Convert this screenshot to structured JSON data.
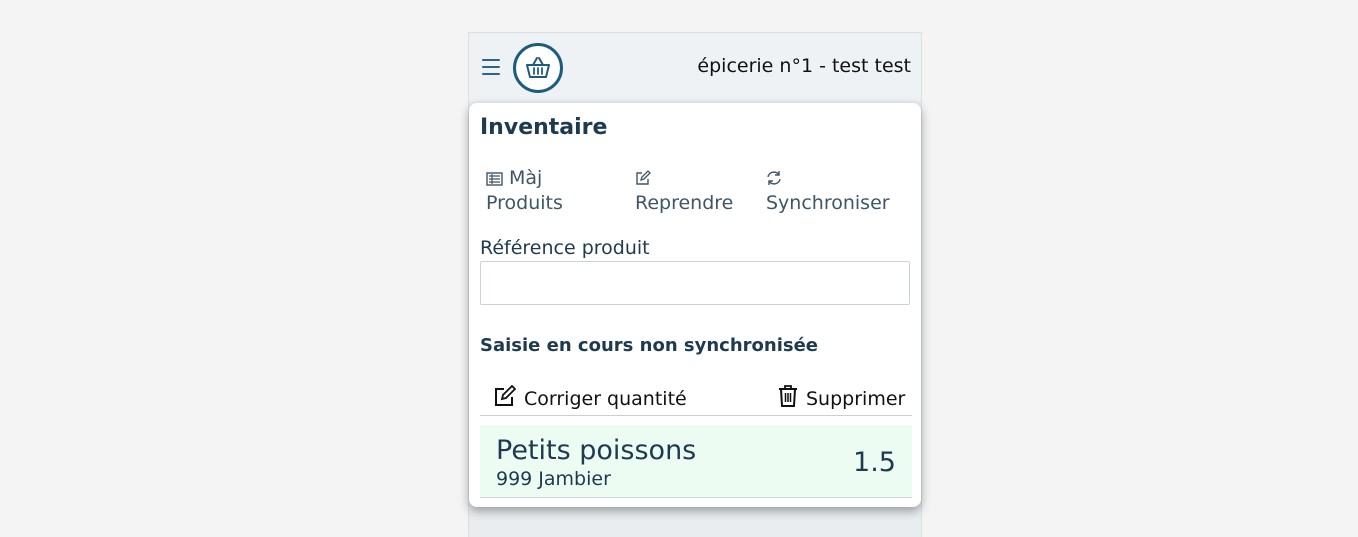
{
  "header": {
    "title": "épicerie n°1 - test test",
    "menu_icon": "hamburger-icon",
    "logo_icon": "basket-icon",
    "accent_color": "#1d5c7f"
  },
  "card": {
    "title": "Inventaire",
    "actions": [
      {
        "label_line1": "Màj",
        "label_line2": "Produits",
        "icon": "list-icon"
      },
      {
        "label_line1": "",
        "label_line2": "Reprendre",
        "icon": "edit-icon"
      },
      {
        "label_line1": "",
        "label_line2": "Synchroniser",
        "icon": "sync-icon"
      }
    ],
    "reference": {
      "label": "Référence produit",
      "value": "",
      "placeholder": ""
    },
    "section_title": "Saisie en cours non synchronisée",
    "toolbar": {
      "edit_label": "Corriger quantité",
      "delete_label": "Supprimer"
    },
    "items": [
      {
        "name": "Petits poissons",
        "sub": "999 Jambier",
        "quantity": "1.5",
        "background": "#ecfcf2"
      }
    ]
  }
}
